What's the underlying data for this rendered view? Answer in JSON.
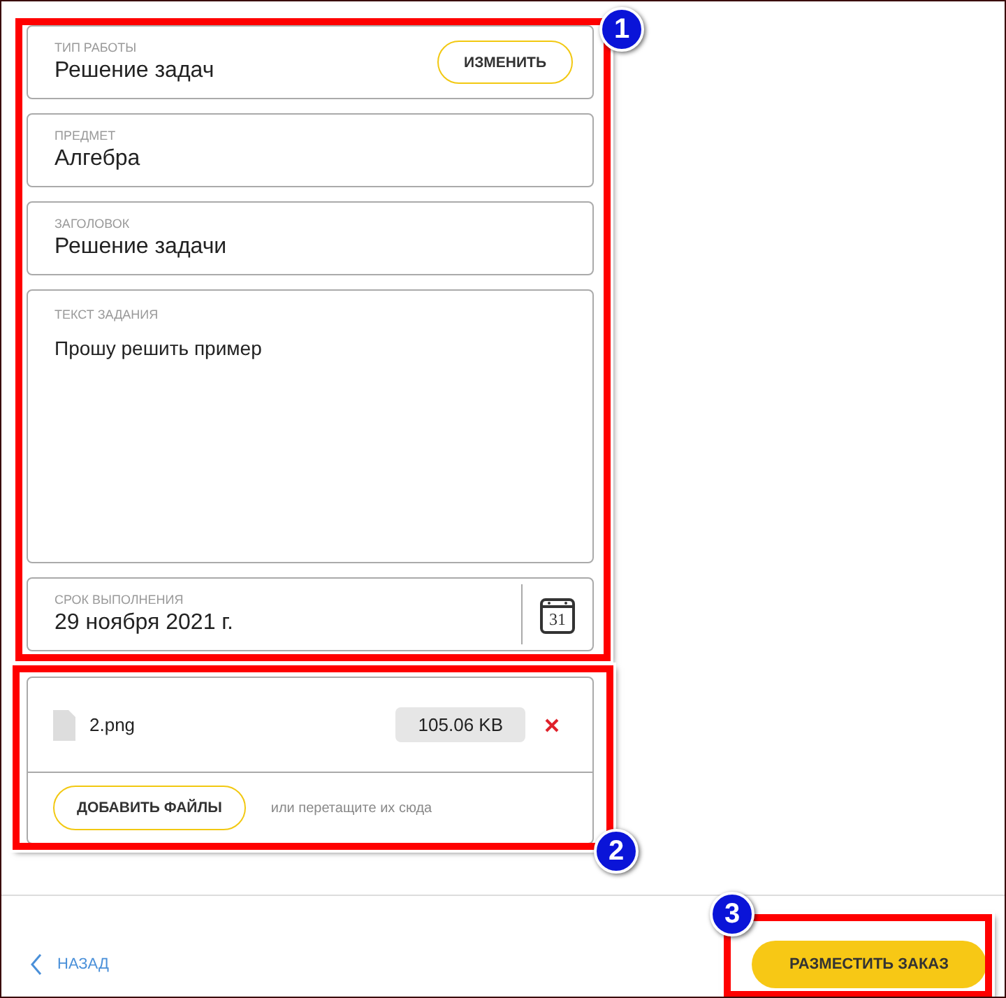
{
  "fields": [
    {
      "kind": "text",
      "label": "ТИП РАБОТЫ",
      "value": "Решение задач",
      "button": "ИЗМЕНИТЬ"
    },
    {
      "kind": "text",
      "label": "ПРЕДМЕТ",
      "value": "Алгебра"
    },
    {
      "kind": "text",
      "label": "ЗАГОЛОВОК",
      "value": "Решение задачи"
    },
    {
      "kind": "textarea",
      "label": "ТЕКСТ ЗАДАНИЯ",
      "value": "Прошу решить пример"
    },
    {
      "kind": "date",
      "label": "СРОК ВЫПОЛНЕНИЯ",
      "value": "29 ноября 2021 г.",
      "icon_text": "31"
    }
  ],
  "files": {
    "items": [
      {
        "name": "2.png",
        "size": "105.06 KB"
      }
    ],
    "add_button": "ДОБАВИТЬ ФАЙЛЫ",
    "drop_hint": "или перетащите их сюда"
  },
  "footer": {
    "back": "НАЗАД",
    "submit": "РАЗМЕСТИТЬ ЗАКАЗ"
  },
  "callouts": [
    {
      "number": "1"
    },
    {
      "number": "2"
    },
    {
      "number": "3"
    }
  ]
}
